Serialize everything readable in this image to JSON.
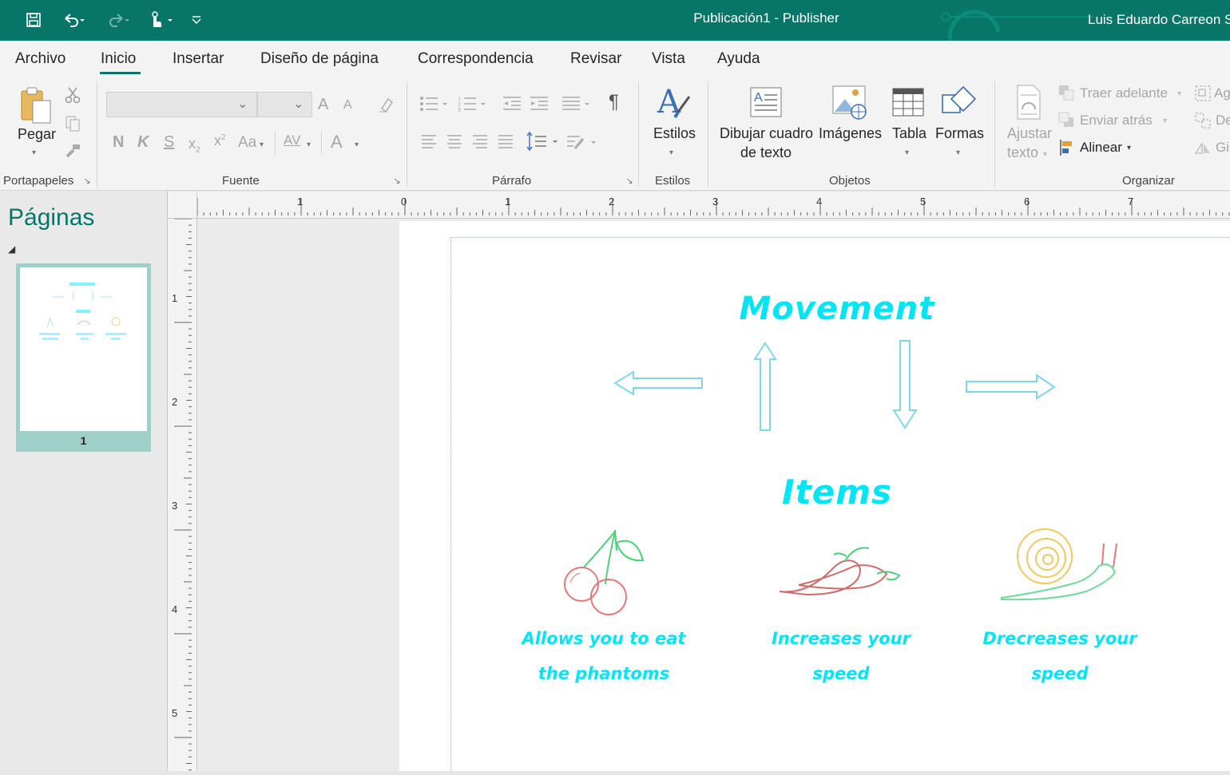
{
  "titlebar": {
    "document_title": "Publicación1  -  Publisher",
    "user": "Luis Eduardo Carreon S",
    "qat_icons": [
      "save-icon",
      "undo-icon",
      "redo-icon",
      "touch-mode-icon",
      "customize-qat-icon"
    ]
  },
  "tabs": [
    "Archivo",
    "Inicio",
    "Insertar",
    "Diseño de página",
    "Correspondencia",
    "Revisar",
    "Vista",
    "Ayuda"
  ],
  "active_tab": "Inicio",
  "ribbon": {
    "clipboard": {
      "paste_label": "Pegar",
      "group_label": "Portapapeles"
    },
    "font": {
      "group_label": "Fuente",
      "bold": "N",
      "italic": "K",
      "strike": "S",
      "subscript": "x",
      "subscript_small": "2",
      "superscript": "x",
      "superscript_small": "2",
      "change_case": "Aa",
      "spacing": "AV",
      "font_color": "A",
      "grow": "A",
      "shrink": "A"
    },
    "paragraph": {
      "group_label": "Párrafo",
      "pilcrow": "¶"
    },
    "styles": {
      "label": "Estilos",
      "group_label": "Estilos"
    },
    "objects": {
      "group_label": "Objetos",
      "textbox_line1": "Dibujar cuadro",
      "textbox_line2": "de texto",
      "images": "Imágenes",
      "table": "Tabla",
      "shapes": "Formas"
    },
    "arrange": {
      "group_label": "Organizar",
      "wrap_line1": "Ajustar",
      "wrap_line2": "texto",
      "bring_forward": "Traer adelante",
      "send_backward": "Enviar atrás",
      "align": "Alinear",
      "group_cut": "Ag",
      "ungroup_cut": "De",
      "rotate_cut": "Gi"
    }
  },
  "pages_pane": {
    "title": "Páginas",
    "page_number": "1"
  },
  "ruler_h_labels": [
    "1",
    "0",
    "1",
    "2",
    "3",
    "4",
    "5",
    "6",
    "7"
  ],
  "ruler_v_labels": [
    "1",
    "2",
    "3",
    "4",
    "5"
  ],
  "publication": {
    "heading_movement": "Movement",
    "heading_items": "Items",
    "captions": [
      {
        "line1": "Allows you to eat",
        "line2": "the phantoms"
      },
      {
        "line1": "Increases your",
        "line2": "speed"
      },
      {
        "line1": "Drecreases your",
        "line2": "speed"
      }
    ],
    "text_color": "#00e5f5",
    "arrow_color": "#6fd3e6",
    "icons": [
      "cherry-icon",
      "chili-pepper-icon",
      "snail-icon"
    ]
  },
  "colors": {
    "accent": "#077568",
    "thumb_selected": "#9ecfc8"
  }
}
